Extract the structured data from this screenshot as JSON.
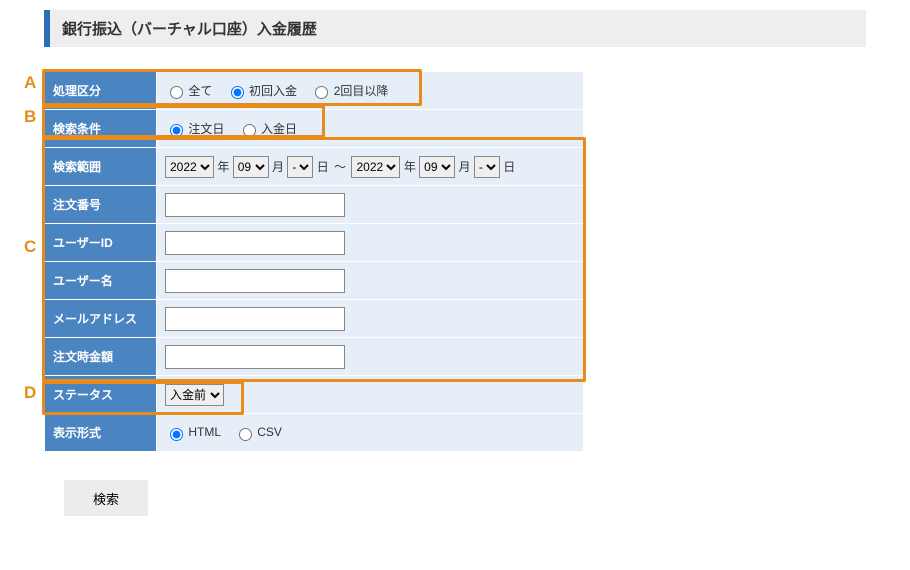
{
  "title": "銀行振込（バーチャル口座）入金履歴",
  "labels": {
    "process_type": "処理区分",
    "search_cond": "検索条件",
    "search_range": "検索範囲",
    "order_no": "注文番号",
    "user_id": "ユーザーID",
    "user_name": "ユーザー名",
    "email": "メールアドレス",
    "order_amount": "注文時金額",
    "status": "ステータス",
    "display_format": "表示形式"
  },
  "process_type": {
    "options": [
      "全て",
      "初回入金",
      "2回目以降"
    ],
    "selected": "初回入金"
  },
  "search_cond": {
    "options": [
      "注文日",
      "入金日"
    ],
    "selected": "注文日"
  },
  "range_units": {
    "year": "年",
    "month": "月",
    "day": "日",
    "to": "～"
  },
  "range_start": {
    "year": "2022",
    "month": "09",
    "day": "-"
  },
  "range_end": {
    "year": "2022",
    "month": "09",
    "day": "-"
  },
  "fields": {
    "order_no": "",
    "user_id": "",
    "user_name": "",
    "email": "",
    "order_amount": ""
  },
  "status": {
    "selected": "入金前"
  },
  "display_format": {
    "options": [
      "HTML",
      "CSV"
    ],
    "selected": "HTML"
  },
  "buttons": {
    "search": "検索"
  },
  "annotations": {
    "A": "A",
    "B": "B",
    "C": "C",
    "D": "D"
  }
}
